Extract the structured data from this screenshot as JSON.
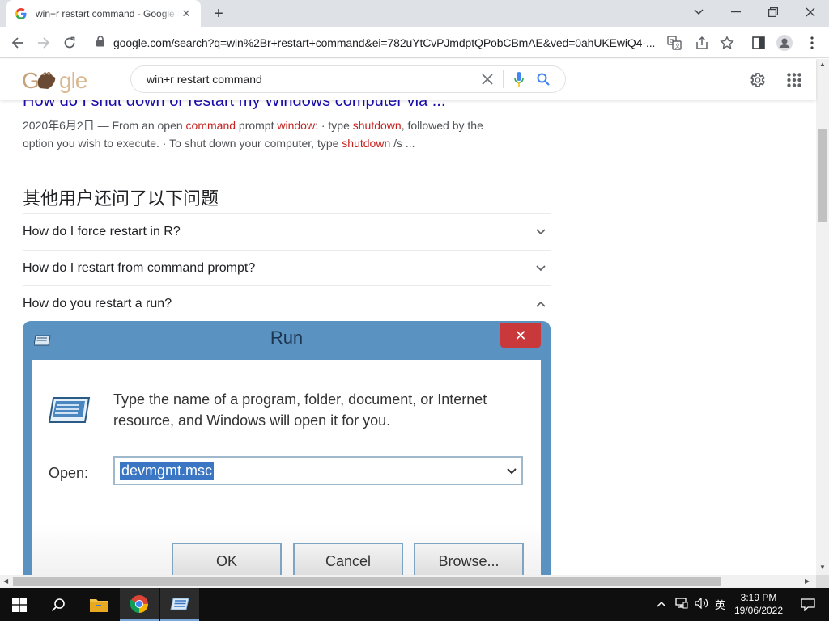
{
  "browser": {
    "tab_title": "win+r restart command - Google Search",
    "tab_favicon": "G",
    "url": "google.com/search?q=win%2Br+restart+command&ei=782uYtCvPJmdptQPobCBmAE&ved=0ahUKEwiQ4-..."
  },
  "google": {
    "logo_text": "Google",
    "query": "win+r restart command"
  },
  "result": {
    "title": "How do I shut down or restart my Windows computer via ...",
    "date": "2020年6月2日",
    "snippet_a": " — From an open ",
    "em1": "command",
    "snippet_b": " prompt ",
    "em2": "window",
    "snippet_c": ": · type ",
    "em3": "shutdown",
    "snippet_d": ", followed by the option you wish to execute. · To shut down your computer, type ",
    "em4": "shutdown",
    "snippet_e": " /s ..."
  },
  "people_also_ask": {
    "heading": "其他用户还问了以下问题",
    "questions": [
      {
        "text": "How do I force restart in R?",
        "expanded": false
      },
      {
        "text": "How do I restart from command prompt?",
        "expanded": false
      },
      {
        "text": "How do you restart a run?",
        "expanded": true
      }
    ]
  },
  "run_dialog": {
    "title": "Run",
    "close_glyph": "✕",
    "description": "Type the name of a program, folder, document, or Internet resource, and Windows will open it for you.",
    "open_label": "Open:",
    "open_value": "devmgmt.msc",
    "buttons": {
      "ok": "OK",
      "cancel": "Cancel",
      "browse": "Browse..."
    }
  },
  "taskbar": {
    "ime": "英",
    "time": "3:19 PM",
    "date": "19/06/2022"
  },
  "colors": {
    "link": "#1a0dab",
    "emphasis": "#c5221f",
    "dialog_frame": "#5a93c2"
  }
}
